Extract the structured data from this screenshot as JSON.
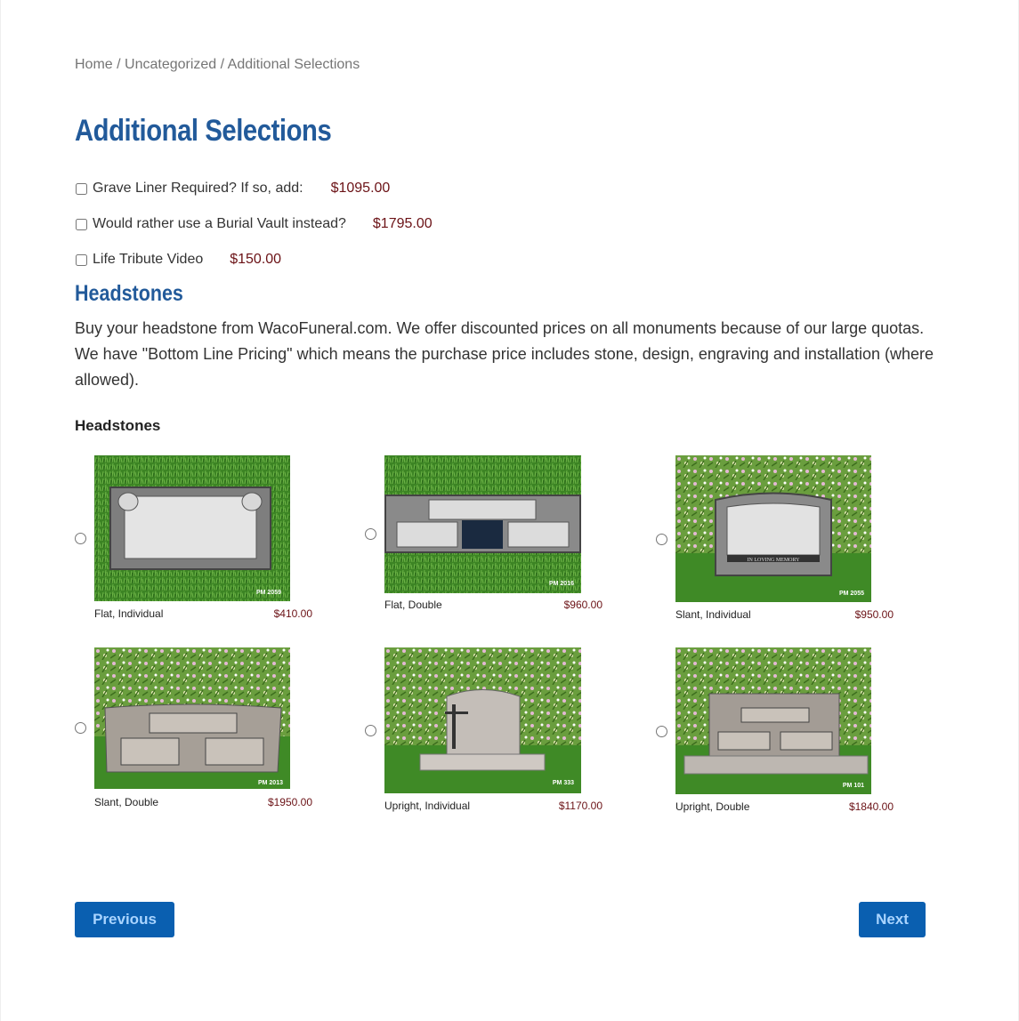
{
  "breadcrumb": {
    "items": [
      "Home",
      "Uncategorized",
      "Additional Selections"
    ],
    "separator": " / "
  },
  "page_title": "Additional Selections",
  "addons": [
    {
      "label": "Grave Liner Required? If so, add:",
      "price": "$1095.00",
      "checked": false
    },
    {
      "label": "Would rather use a Burial Vault instead?",
      "price": "$1795.00",
      "checked": false
    },
    {
      "label": "Life Tribute Video",
      "price": "$150.00",
      "checked": false
    }
  ],
  "headstones_section": {
    "title": "Headstones",
    "intro": "Buy your headstone from WacoFuneral.com. We offer discounted prices on all monuments because of our large quotas. We have \"Bottom Line Pricing\" which means the purchase price includes stone, design, engraving and installation (where allowed).",
    "group_label": "Headstones",
    "options": [
      {
        "name": "Flat, Individual",
        "price": "$410.00",
        "model": "PM 2059",
        "background": "grass",
        "selected": false
      },
      {
        "name": "Flat, Double",
        "price": "$960.00",
        "model": "PM 2016",
        "background": "grass",
        "selected": false
      },
      {
        "name": "Slant, Individual",
        "price": "$950.00",
        "model": "PM 2055",
        "background": "flowers",
        "engraving": "IN LOVING MEMORY",
        "selected": false
      },
      {
        "name": "Slant, Double",
        "price": "$1950.00",
        "model": "PM 2013",
        "background": "flowers",
        "selected": false
      },
      {
        "name": "Upright, Individual",
        "price": "$1170.00",
        "model": "PM 333",
        "background": "flowers",
        "selected": false
      },
      {
        "name": "Upright, Double",
        "price": "$1840.00",
        "model": "PM 101",
        "background": "flowers",
        "selected": false
      }
    ]
  },
  "nav": {
    "previous_label": "Previous",
    "next_label": "Next"
  },
  "colors": {
    "heading": "#225a9a",
    "price": "#6b1216",
    "button_bg": "#0a5fb0",
    "button_text": "#a9d4ff"
  }
}
